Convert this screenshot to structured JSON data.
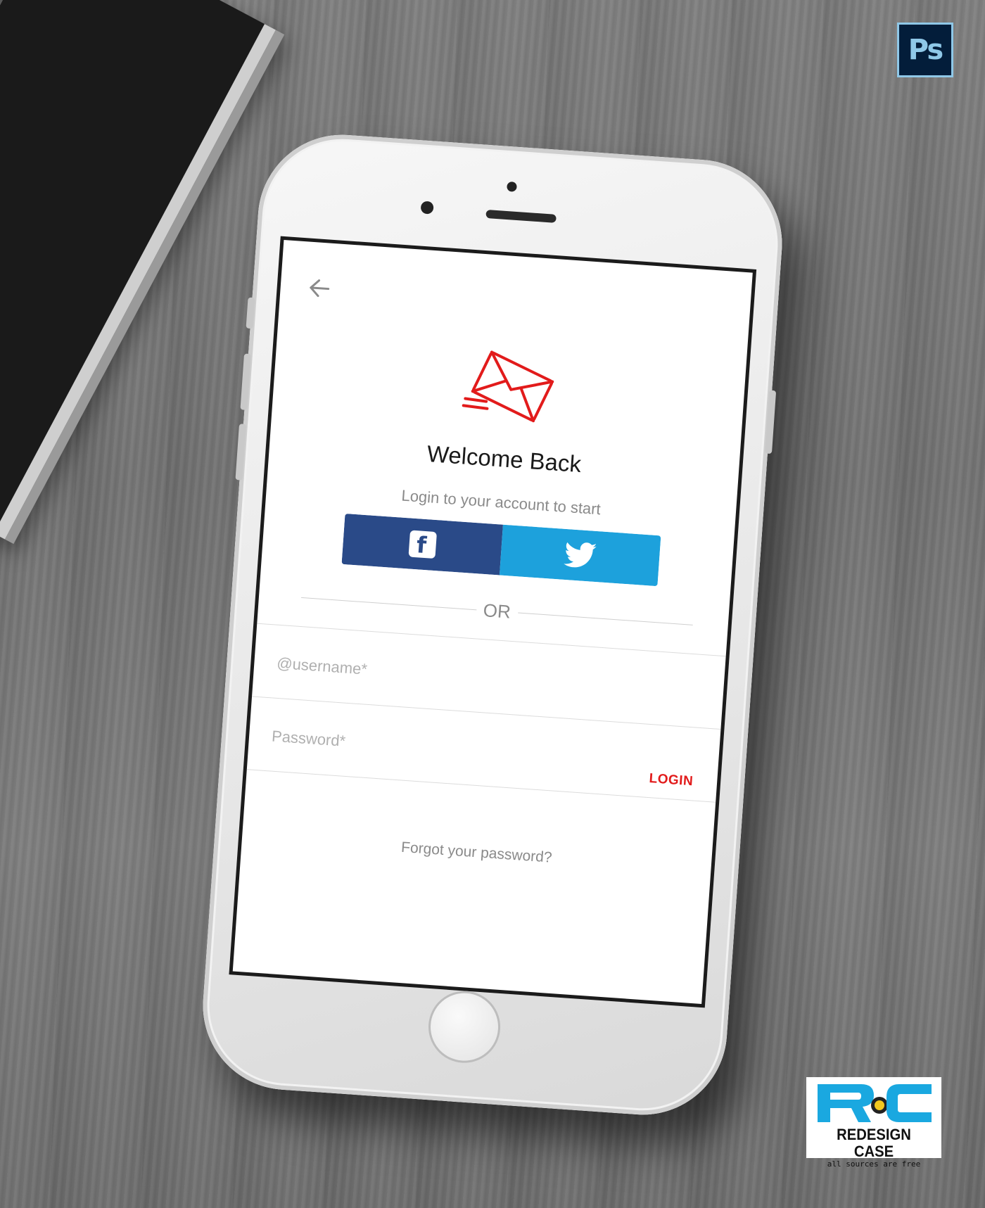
{
  "app": {
    "title": "Welcome Back",
    "subtitle": "Login to your account to start"
  },
  "social": {
    "facebook_letter": "f"
  },
  "divider": {
    "label": "OR"
  },
  "form": {
    "username_placeholder": "@username*",
    "password_placeholder": "Password*",
    "login_label": "LOGIN"
  },
  "forgot_password": "Forgot your password?",
  "watermarks": {
    "photoshop_badge": "Ps",
    "brand_title": "REDESIGN CASE",
    "brand_tagline": "all sources are free"
  },
  "icons": [
    "back-arrow-icon",
    "mail-icon",
    "facebook-icon",
    "twitter-icon"
  ],
  "colors": {
    "accent": "#e21b1b",
    "facebook": "#2a4a88",
    "twitter": "#1da1dc",
    "ps_badge_bg": "#031d3a",
    "ps_badge_fg": "#8fc8e8",
    "brand_cyan": "#1aa8e0",
    "brand_yellow": "#f2c81e"
  }
}
